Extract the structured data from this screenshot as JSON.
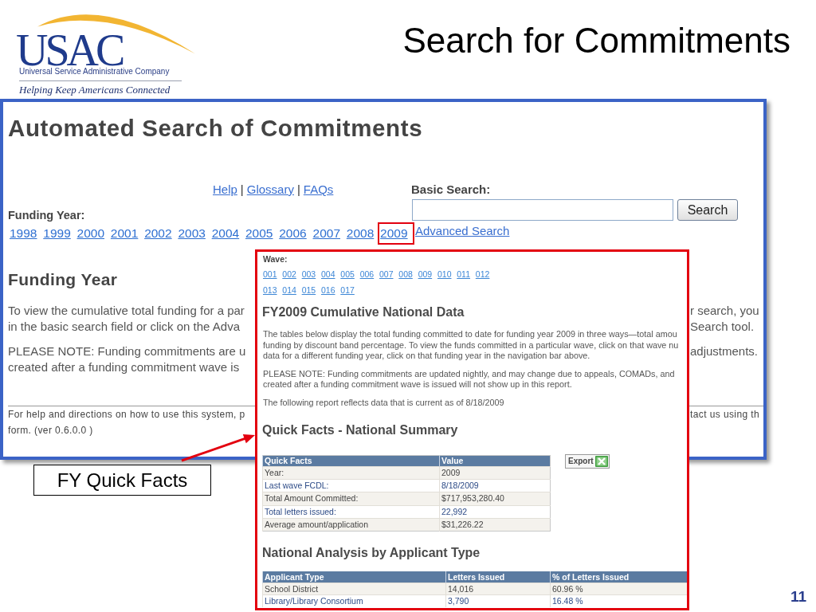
{
  "slide": {
    "title": "Search for Commitments",
    "page_number": "11"
  },
  "logo": {
    "wordmark": "USAC",
    "company": "Universal Service Administrative Company",
    "tagline": "Helping Keep Americans Connected"
  },
  "main_screenshot": {
    "heading": "Automated Search of Commitments",
    "help_links": [
      {
        "kind": "link",
        "text": "Help"
      },
      {
        "kind": "separator",
        "text": "|"
      },
      {
        "kind": "link",
        "text": "Glossary"
      },
      {
        "kind": "separator",
        "text": "|"
      },
      {
        "kind": "link",
        "text": "FAQs"
      }
    ],
    "funding_year_label": "Funding Year:",
    "years": [
      {
        "label": "1998",
        "highlighted": false
      },
      {
        "label": "1999",
        "highlighted": false
      },
      {
        "label": "2000",
        "highlighted": false
      },
      {
        "label": "2001",
        "highlighted": false
      },
      {
        "label": "2002",
        "highlighted": false
      },
      {
        "label": "2003",
        "highlighted": false
      },
      {
        "label": "2004",
        "highlighted": false
      },
      {
        "label": "2005",
        "highlighted": false
      },
      {
        "label": "2006",
        "highlighted": false
      },
      {
        "label": "2007",
        "highlighted": false
      },
      {
        "label": "2008",
        "highlighted": false
      },
      {
        "label": "2009",
        "highlighted": true
      }
    ],
    "basic_search": {
      "label": "Basic Search:",
      "button": "Search",
      "advanced_link": "Advanced Search"
    },
    "section_heading": "Funding Year",
    "paragraphs": [
      {
        "left_lines": [
          "To view the cumulative total funding for a par",
          "in the basic search field or click on the Adva"
        ],
        "right_lines": [
          "r search, you",
          "Search tool."
        ]
      },
      {
        "left_lines": [
          "PLEASE NOTE: Funding commitments are u",
          "created after a funding commitment wave is"
        ],
        "right_lines": [
          "adjustments."
        ]
      }
    ],
    "footer": {
      "left_lines": [
        "For help and directions on how to use this system, p",
        "form. (ver 0.6.0.0 )"
      ],
      "right_lines": [
        "tact us using th"
      ]
    }
  },
  "inset_screenshot": {
    "wave_label": "Wave:",
    "waves": [
      "001",
      "002",
      "003",
      "004",
      "005",
      "006",
      "007",
      "008",
      "009",
      "010",
      "011",
      "012",
      "013",
      "014",
      "015",
      "016",
      "017"
    ],
    "heading": "FY2009 Cumulative National Data",
    "paragraphs": [
      [
        "The tables below display the total funding committed to date for funding year 2009 in three ways—total amou",
        "funding by discount band percentage. To view the funds committed in a particular wave, click on that wave nu",
        "data for a different funding year, click on that funding year in the navigation bar above."
      ],
      [
        "PLEASE NOTE: Funding commitments are updated nightly, and may change due to appeals, COMADs, and",
        "created after a funding commitment wave is issued will not show up in this report."
      ],
      [
        "The following report reflects data that is current as of 8/18/2009"
      ]
    ],
    "quick_facts": {
      "heading": "Quick Facts - National Summary",
      "columns": [
        "Quick Facts",
        "Value"
      ],
      "rows": [
        [
          "Year:",
          "2009"
        ],
        [
          "Last wave FCDL:",
          "8/18/2009"
        ],
        [
          "Total Amount Committed:",
          "$717,953,280.40"
        ],
        [
          "Total letters issued:",
          "22,992"
        ],
        [
          "Average amount/application",
          "$31,226.22"
        ]
      ],
      "export_button": "Export"
    },
    "applicant_types": {
      "heading": "National Analysis by Applicant Type",
      "columns": [
        "Applicant Type",
        "Letters Issued",
        "% of Letters Issued"
      ],
      "rows": [
        [
          "School District",
          "14,016",
          "60.96 %"
        ],
        [
          "Library/Library Consortium",
          "3,790",
          "16.48 %"
        ]
      ]
    }
  },
  "callout": {
    "text": "FY Quick Facts"
  }
}
